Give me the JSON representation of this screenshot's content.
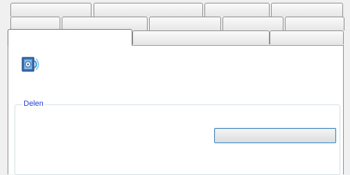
{
  "tabs": {
    "row1": [
      "",
      "",
      "",
      ""
    ],
    "row2": [
      "",
      "",
      "",
      "",
      ""
    ],
    "row3": [
      "",
      "",
      ""
    ]
  },
  "panel": {
    "description": "",
    "group_title": "Delen",
    "group_text": "",
    "share_button_label": ""
  }
}
